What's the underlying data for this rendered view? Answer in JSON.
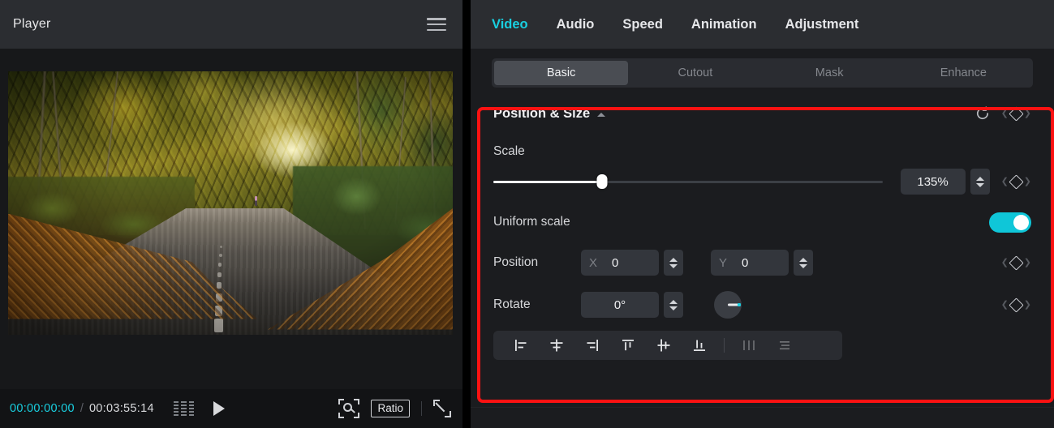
{
  "player": {
    "title": "Player",
    "menu_icon": "hamburger-icon",
    "preview": {
      "description": "Autumn forest road covered with fallen orange leaves, golden canopy overhead, lone walker in the distance"
    },
    "controls": {
      "current_time": "00:00:00:00",
      "separator": "/",
      "total_time": "00:03:55:14",
      "frames_icon": "frames-grid-icon",
      "play_icon": "play-icon",
      "crop_icon": "zoom-crop-icon",
      "ratio_label": "Ratio",
      "expand_icon": "fullscreen-expand-icon"
    }
  },
  "properties": {
    "top_tabs": [
      {
        "label": "Video",
        "active": true
      },
      {
        "label": "Audio",
        "active": false
      },
      {
        "label": "Speed",
        "active": false
      },
      {
        "label": "Animation",
        "active": false
      },
      {
        "label": "Adjustment",
        "active": false
      }
    ],
    "sub_tabs": [
      {
        "label": "Basic",
        "active": true
      },
      {
        "label": "Cutout",
        "active": false
      },
      {
        "label": "Mask",
        "active": false
      },
      {
        "label": "Enhance",
        "active": false
      }
    ],
    "section": {
      "title": "Position & Size",
      "collapse_icon": "caret-up-icon",
      "reset_icon": "reset-icon",
      "keyframe_icon": "keyframe-diamond-icon",
      "scale": {
        "label": "Scale",
        "value": "135%",
        "slider_percent": 28,
        "stepper_icon": "stepper-updown-icon",
        "keyframe_icon": "keyframe-diamond-icon"
      },
      "uniform_scale": {
        "label": "Uniform scale",
        "enabled": true,
        "toggle_icon": "toggle-switch-icon"
      },
      "position": {
        "label": "Position",
        "x_axis": "X",
        "x_value": "0",
        "y_axis": "Y",
        "y_value": "0",
        "stepper_icon": "stepper-updown-icon",
        "keyframe_icon": "keyframe-diamond-icon"
      },
      "rotate": {
        "label": "Rotate",
        "value": "0°",
        "stepper_icon": "stepper-updown-icon",
        "dial_icon": "rotation-dial-icon",
        "keyframe_icon": "keyframe-diamond-icon"
      },
      "align_buttons": [
        {
          "name": "align-left-icon",
          "dim": false
        },
        {
          "name": "align-center-horizontal-icon",
          "dim": false
        },
        {
          "name": "align-right-icon",
          "dim": false
        },
        {
          "name": "align-top-icon",
          "dim": false
        },
        {
          "name": "align-middle-vertical-icon",
          "dim": false
        },
        {
          "name": "align-bottom-icon",
          "dim": false
        },
        {
          "name": "distribute-horizontal-icon",
          "dim": true
        },
        {
          "name": "distribute-vertical-icon",
          "dim": true
        }
      ]
    }
  },
  "colors": {
    "accent_cyan": "#19cfe0",
    "highlight_red": "#fb1212",
    "panel_bg": "#1b1c1f",
    "header_bg": "#2b2d31",
    "field_bg": "#33363c",
    "toggle_on": "#0fc6d8"
  }
}
